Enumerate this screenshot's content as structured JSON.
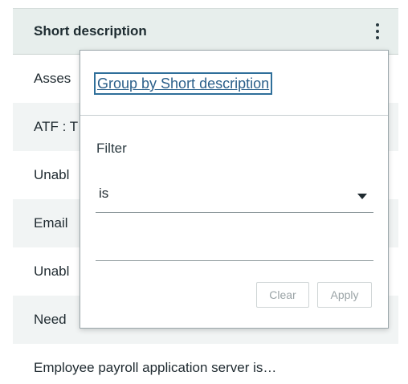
{
  "column": {
    "title": "Short description",
    "menu_icon": "kebab-vertical-icon"
  },
  "rows": [
    "Asses",
    "ATF : T",
    "Unabl",
    "Email",
    "Unabl",
    "Need",
    "Employee payroll application server is…"
  ],
  "popover": {
    "group_by_label": "Group by Short description",
    "filter_label": "Filter",
    "operator": "is",
    "operator_icon": "caret-down-icon",
    "filter_value": "",
    "clear_label": "Clear",
    "apply_label": "Apply"
  }
}
